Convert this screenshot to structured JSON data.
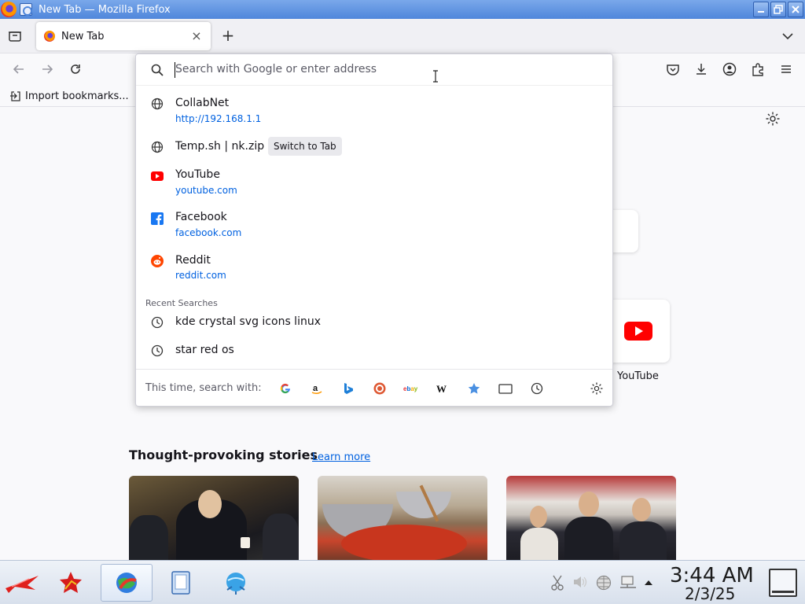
{
  "window": {
    "title": "New Tab — Mozilla Firefox",
    "controls": [
      "minimize",
      "maximize",
      "close"
    ]
  },
  "tabs": [
    {
      "label": "New Tab",
      "active": true
    }
  ],
  "navbar": {
    "url_placeholder": "Search with Google or enter address"
  },
  "bookmarks_bar": {
    "import_label": "Import bookmarks..."
  },
  "urlbar_dropdown": {
    "results": [
      {
        "title": "CollabNet",
        "url": "http://192.168.1.1",
        "icon": "globe-icon"
      },
      {
        "title": "Temp.sh | nk.zip",
        "action": "Switch to Tab",
        "icon": "globe-icon"
      },
      {
        "title": "YouTube",
        "url": "youtube.com",
        "icon": "youtube-icon"
      },
      {
        "title": "Facebook",
        "url": "facebook.com",
        "icon": "facebook-icon"
      },
      {
        "title": "Reddit",
        "url": "reddit.com",
        "icon": "reddit-icon"
      }
    ],
    "recent_searches_heading": "Recent Searches",
    "recent_searches": [
      {
        "text": "kde crystal svg icons linux",
        "icon": "history-icon"
      },
      {
        "text": "star red os",
        "icon": "history-icon"
      }
    ],
    "search_with_label": "This time, search with:",
    "engines": [
      "google",
      "amazon",
      "bing",
      "duckduckgo",
      "ebay",
      "wikipedia",
      "bookmarks",
      "tabs",
      "history"
    ]
  },
  "newtab": {
    "shortcut_youtube_label": "YouTube",
    "stories_heading": "Thought-provoking stories",
    "learn_more": "Learn more"
  },
  "taskbar": {
    "time": "3:44 AM",
    "date": "2/3/25"
  },
  "colors": {
    "titlebar": "#4f86db",
    "link": "#0061e0",
    "youtube_red": "#ff0000",
    "facebook_blue": "#1877f2",
    "reddit_orange": "#ff4500"
  }
}
